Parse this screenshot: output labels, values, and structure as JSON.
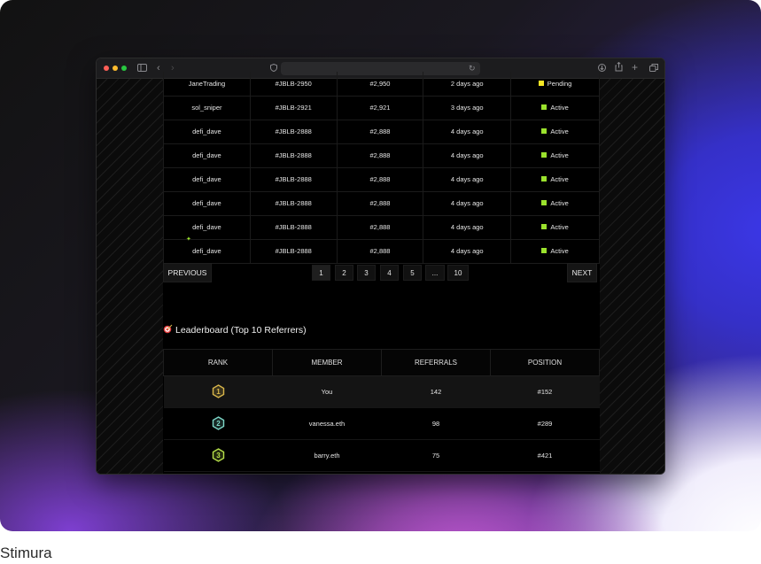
{
  "caption": "Stimura",
  "browser": {
    "traffic_lights": {
      "close": "#ff5f57",
      "minimize": "#febc2e",
      "zoom": "#28c840"
    },
    "icons": [
      "sidebar-icon",
      "back-icon",
      "forward-icon",
      "shield-icon",
      "reload-icon",
      "download-icon",
      "share-icon",
      "new-tab-icon",
      "tabs-overview-icon"
    ]
  },
  "referrals": {
    "rows": [
      {
        "user": "JaneTrading",
        "code": "#JBLB-2950",
        "id": "#2,950",
        "time": "2 days ago",
        "status": "Pending",
        "status_color": "#f5e625"
      },
      {
        "user": "sol_sniper",
        "code": "#JBLB-2921",
        "id": "#2,921",
        "time": "3 days ago",
        "status": "Active",
        "status_color": "#9be22d"
      },
      {
        "user": "defi_dave",
        "code": "#JBLB-2888",
        "id": "#2,888",
        "time": "4 days ago",
        "status": "Active",
        "status_color": "#9be22d"
      },
      {
        "user": "defi_dave",
        "code": "#JBLB-2888",
        "id": "#2,888",
        "time": "4 days ago",
        "status": "Active",
        "status_color": "#9be22d"
      },
      {
        "user": "defi_dave",
        "code": "#JBLB-2888",
        "id": "#2,888",
        "time": "4 days ago",
        "status": "Active",
        "status_color": "#9be22d"
      },
      {
        "user": "defi_dave",
        "code": "#JBLB-2888",
        "id": "#2,888",
        "time": "4 days ago",
        "status": "Active",
        "status_color": "#9be22d"
      },
      {
        "user": "defi_dave",
        "code": "#JBLB-2888",
        "id": "#2,888",
        "time": "4 days ago",
        "status": "Active",
        "status_color": "#9be22d"
      },
      {
        "user": "defi_dave",
        "code": "#JBLB-2888",
        "id": "#2,888",
        "time": "4 days ago",
        "status": "Active",
        "status_color": "#9be22d"
      }
    ]
  },
  "pagination": {
    "previous": "PREVIOUS",
    "next": "NEXT",
    "pages": [
      "1",
      "2",
      "3",
      "4",
      "5",
      "...",
      "10"
    ],
    "current": "1"
  },
  "leaderboard": {
    "title": "Leaderboard (Top 10 Referrers)",
    "title_icon": "target-icon",
    "columns": [
      "RANK",
      "MEMBER",
      "REFERRALS",
      "POSITION"
    ],
    "rows": [
      {
        "rank": "1",
        "member": "You",
        "referrals": "142",
        "position": "#152",
        "badge_color": "#d9b64a"
      },
      {
        "rank": "2",
        "member": "vanessa.eth",
        "referrals": "98",
        "position": "#289",
        "badge_color": "#7ed8c9"
      },
      {
        "rank": "3",
        "member": "barry.eth",
        "referrals": "75",
        "position": "#421",
        "badge_color": "#b7e04a"
      }
    ]
  }
}
